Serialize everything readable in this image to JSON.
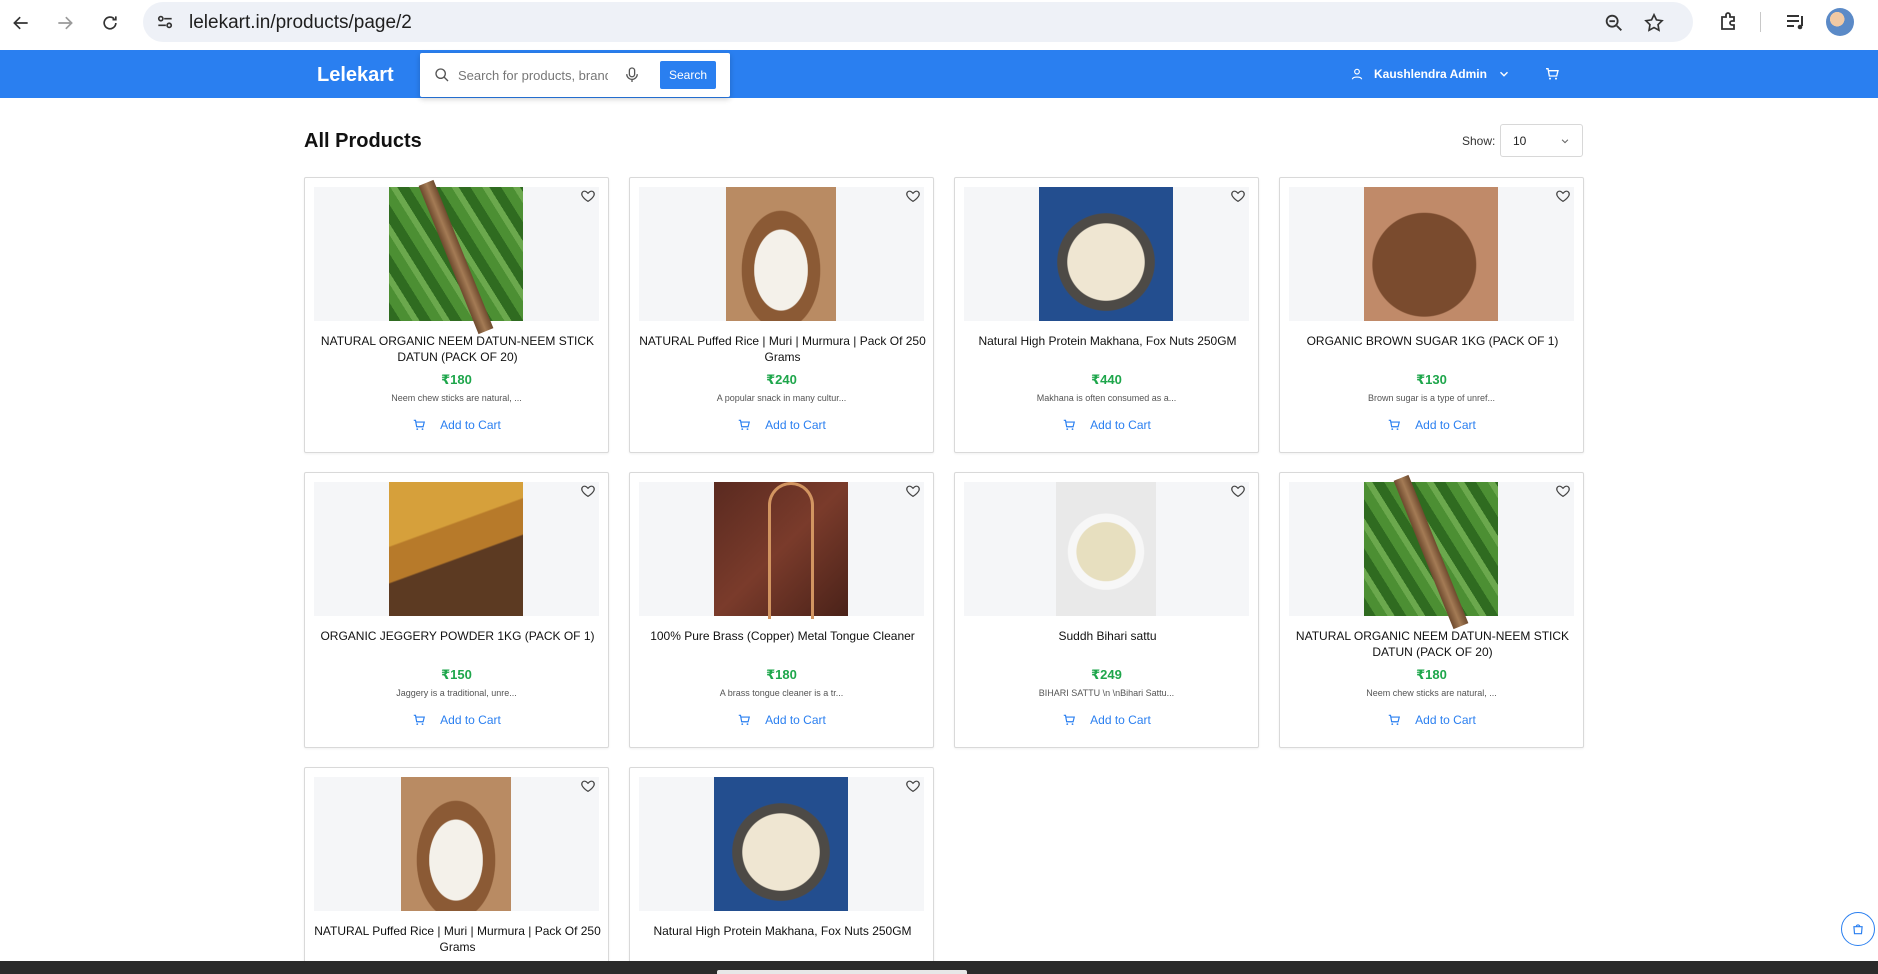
{
  "browser": {
    "url": "lelekart.in/products/page/2",
    "icons": [
      "back-arrow-icon",
      "forward-arrow-icon",
      "reload-icon",
      "site-info-icon",
      "zoom-icon",
      "star-icon",
      "extension-icon",
      "media-icon",
      "profile-avatar-icon"
    ]
  },
  "header": {
    "logo": "Lelekart",
    "search_placeholder": "Search for products, brands",
    "search_button": "Search",
    "user_name": "Kaushlendra Admin",
    "accent_color": "#2a7ff0"
  },
  "main": {
    "title": "All Products",
    "show_label": "Show:",
    "show_value": "10",
    "products": [
      {
        "name": "NATURAL ORGANIC NEEM DATUN-NEEM STICK DATUN (PACK OF 20)",
        "price": "₹180",
        "description": "Neem chew sticks are natural, ...",
        "cta": "Add to Cart",
        "image": "neem-sticks-image"
      },
      {
        "name": "NATURAL Puffed Rice | Muri | Murmura | Pack Of 250 Grams",
        "price": "₹240",
        "description": "A popular snack in many cultur...",
        "cta": "Add to Cart",
        "image": "puffed-rice-image"
      },
      {
        "name": "Natural High Protein Makhana, Fox Nuts 250GM",
        "price": "₹440",
        "description": "Makhana is often consumed as a...",
        "cta": "Add to Cart",
        "image": "makhana-image"
      },
      {
        "name": "ORGANIC BROWN SUGAR 1KG (PACK OF 1)",
        "price": "₹130",
        "description": "Brown sugar is a type of unref...",
        "cta": "Add to Cart",
        "image": "brown-sugar-image"
      },
      {
        "name": "ORGANIC JEGGERY POWDER 1KG (PACK OF 1)",
        "price": "₹150",
        "description": "Jaggery is a traditional, unre...",
        "cta": "Add to Cart",
        "image": "jaggery-powder-image"
      },
      {
        "name": "100% Pure Brass (Copper) Metal Tongue Cleaner",
        "price": "₹180",
        "description": "A brass tongue cleaner is a tr...",
        "cta": "Add to Cart",
        "image": "tongue-cleaner-image"
      },
      {
        "name": "Suddh Bihari sattu",
        "price": "₹249",
        "description": "BIHARI SATTU \\n \\nBihari Sattu...",
        "cta": "Add to Cart",
        "image": "sattu-image"
      },
      {
        "name": "NATURAL ORGANIC NEEM DATUN-NEEM STICK DATUN (PACK OF 20)",
        "price": "₹180",
        "description": "Neem chew sticks are natural, ...",
        "cta": "Add to Cart",
        "image": "neem-sticks-image"
      },
      {
        "name": "NATURAL Puffed Rice | Muri | Murmura | Pack Of 250 Grams",
        "image": "puffed-rice-image"
      },
      {
        "name": "Natural High Protein Makhana, Fox Nuts 250GM",
        "image": "makhana-image"
      }
    ]
  },
  "colors": {
    "price_green": "#1ea64b",
    "link_blue": "#2a7ff0"
  }
}
